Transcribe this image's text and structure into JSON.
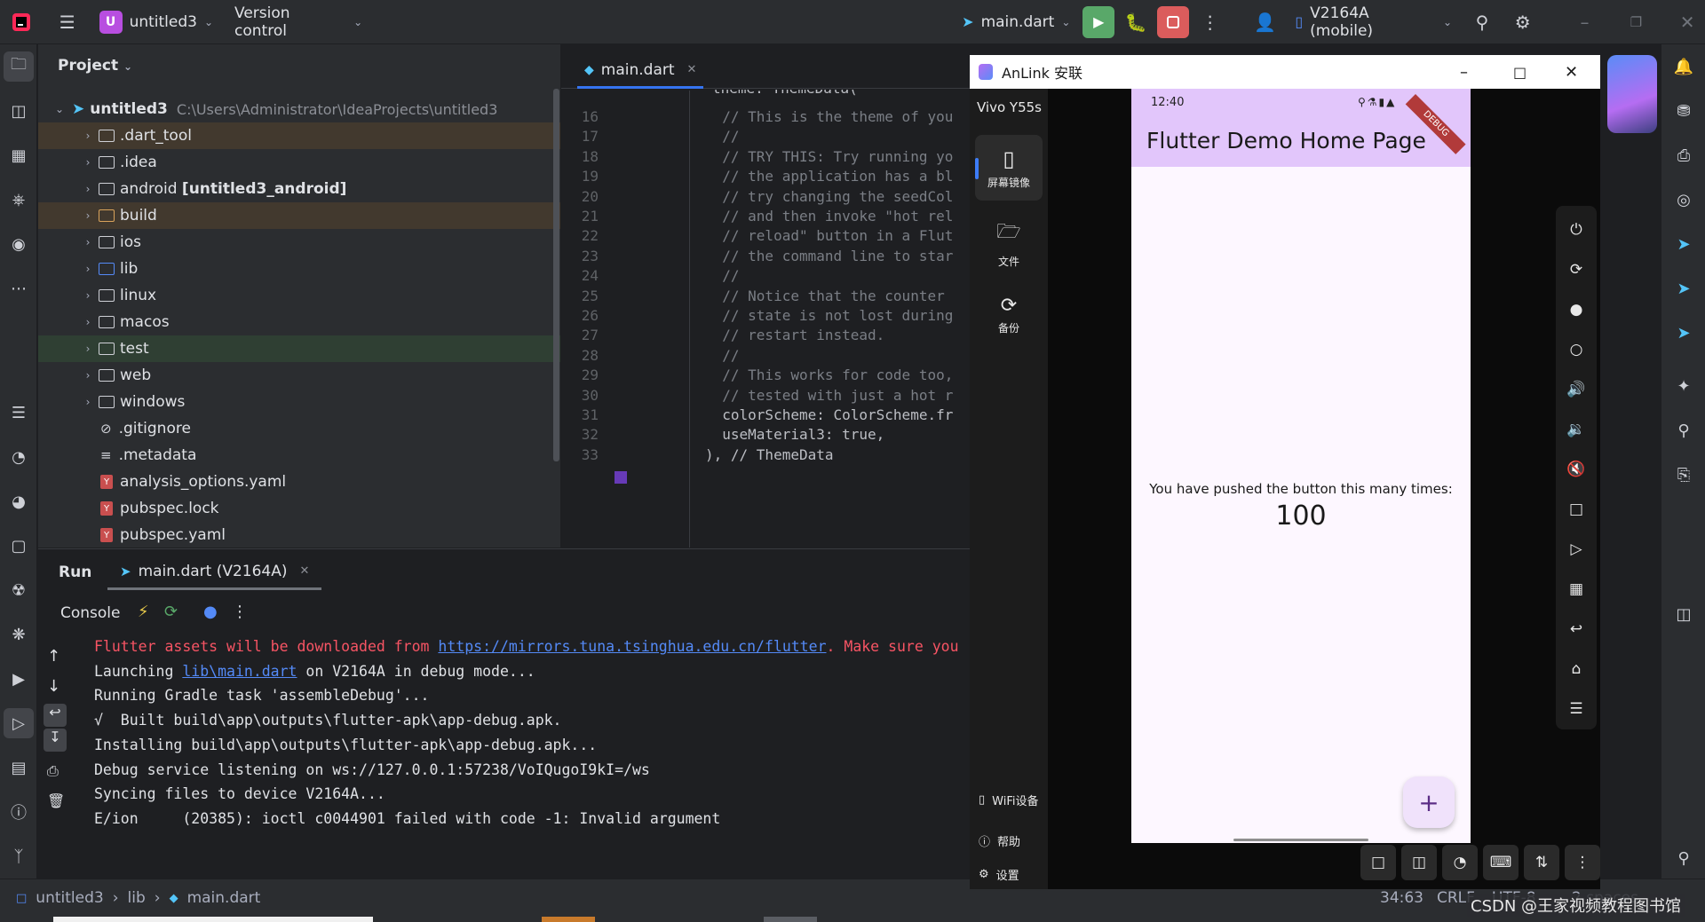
{
  "titlebar": {
    "project_badge": "U",
    "project_name": "untitled3",
    "version_control": "Version control",
    "run_config": "main.dart",
    "device": "V2164A (mobile)"
  },
  "project_panel": {
    "header": "Project",
    "root_name": "untitled3",
    "root_path": "C:\\Users\\Administrator\\IdeaProjects\\untitled3",
    "items": [
      {
        "label": ".dart_tool",
        "suffix": ""
      },
      {
        "label": ".idea",
        "suffix": ""
      },
      {
        "label": "android ",
        "suffix": "[untitled3_android]"
      },
      {
        "label": "build",
        "suffix": ""
      },
      {
        "label": "ios",
        "suffix": ""
      },
      {
        "label": "lib",
        "suffix": ""
      },
      {
        "label": "linux",
        "suffix": ""
      },
      {
        "label": "macos",
        "suffix": ""
      },
      {
        "label": "test",
        "suffix": ""
      },
      {
        "label": "web",
        "suffix": ""
      },
      {
        "label": "windows",
        "suffix": ""
      },
      {
        "label": ".gitignore",
        "suffix": ""
      },
      {
        "label": ".metadata",
        "suffix": ""
      },
      {
        "label": "analysis_options.yaml",
        "suffix": ""
      },
      {
        "label": "pubspec.lock",
        "suffix": ""
      },
      {
        "label": "pubspec.yaml",
        "suffix": ""
      }
    ]
  },
  "editor": {
    "tab_label": "main.dart",
    "lines": [
      {
        "n": "16",
        "text": "  // This is the theme of you"
      },
      {
        "n": "17",
        "text": "  //"
      },
      {
        "n": "18",
        "text": "  // TRY THIS: Try running yo"
      },
      {
        "n": "19",
        "text": "  // the application has a bl"
      },
      {
        "n": "20",
        "text": "  // try changing the seedCol"
      },
      {
        "n": "21",
        "text": "  // and then invoke \"hot rel"
      },
      {
        "n": "22",
        "text": "  // reload\" button in a Flut"
      },
      {
        "n": "23",
        "text": "  // the command line to star"
      },
      {
        "n": "24",
        "text": "  //"
      },
      {
        "n": "25",
        "text": "  // Notice that the counter"
      },
      {
        "n": "26",
        "text": "  // state is not lost during"
      },
      {
        "n": "27",
        "text": "  // restart instead."
      },
      {
        "n": "28",
        "text": "  //"
      },
      {
        "n": "29",
        "text": "  // This works for code too,"
      },
      {
        "n": "30",
        "text": "  // tested with just a hot r"
      },
      {
        "n": "31",
        "text": "  colorScheme: ColorScheme.fr"
      },
      {
        "n": "32",
        "text": "  useMaterial3: true,"
      },
      {
        "n": "33",
        "text": "), // ThemeData"
      }
    ],
    "partial_top_line": "theme: ThemeData("
  },
  "run_panel": {
    "title": "Run",
    "tab_label": "main.dart (V2164A)",
    "console_label": "Console",
    "lines": [
      {
        "text": "Flutter assets will be downloaded from ",
        "link": "https://mirrors.tuna.tsinghua.edu.cn/flutter",
        "after": ". Make sure you",
        "style": "err"
      },
      {
        "text": "Launching ",
        "link": "lib\\main.dart",
        "after": " on V2164A in debug mode...",
        "style": "normal"
      },
      {
        "text": "Running Gradle task 'assembleDebug'...",
        "link": "",
        "after": "",
        "style": "normal"
      },
      {
        "text": "√  Built build\\app\\outputs\\flutter-apk\\app-debug.apk.",
        "link": "",
        "after": "",
        "style": "normal"
      },
      {
        "text": "Installing build\\app\\outputs\\flutter-apk\\app-debug.apk...",
        "link": "",
        "after": "",
        "style": "normal"
      },
      {
        "text": "Debug service listening on ws://127.0.0.1:57238/VoIQugoI9kI=/ws",
        "link": "",
        "after": "",
        "style": "normal"
      },
      {
        "text": "Syncing files to device V2164A...",
        "link": "",
        "after": "",
        "style": "normal"
      },
      {
        "text": "E/ion     (20385): ioctl c0044901 failed with code -1: Invalid argument",
        "link": "",
        "after": "",
        "style": "normal"
      }
    ]
  },
  "statusbar": {
    "crumbs": [
      "untitled3",
      "lib",
      "main.dart"
    ],
    "position": "34:63",
    "line_sep": "CRLF",
    "encoding": "UTF-8",
    "indent": "2 spaces",
    "watermark": "CSDN @王家视频教程图书馆"
  },
  "anlink": {
    "title": "AnLink 安联",
    "device_name": "Vivo Y55s",
    "side_buttons": [
      "屏幕镜像",
      "文件",
      "备份"
    ],
    "bottom_links": [
      "WiFi设备",
      "帮助",
      "设置"
    ]
  },
  "phone": {
    "time": "12:40",
    "debug_banner": "DEBUG",
    "appbar_title": "Flutter Demo Home Page",
    "counter_label": "You have pushed the button this many times:",
    "counter_value": "100",
    "fab_label": "+"
  },
  "colors": {
    "ide_bg": "#1e1f22",
    "panel_bg": "#2b2d30",
    "accent": "#3574f0",
    "run_green": "#59a869",
    "stop_red": "#db5c5c",
    "appbar_purple": "#e2c6fb"
  }
}
